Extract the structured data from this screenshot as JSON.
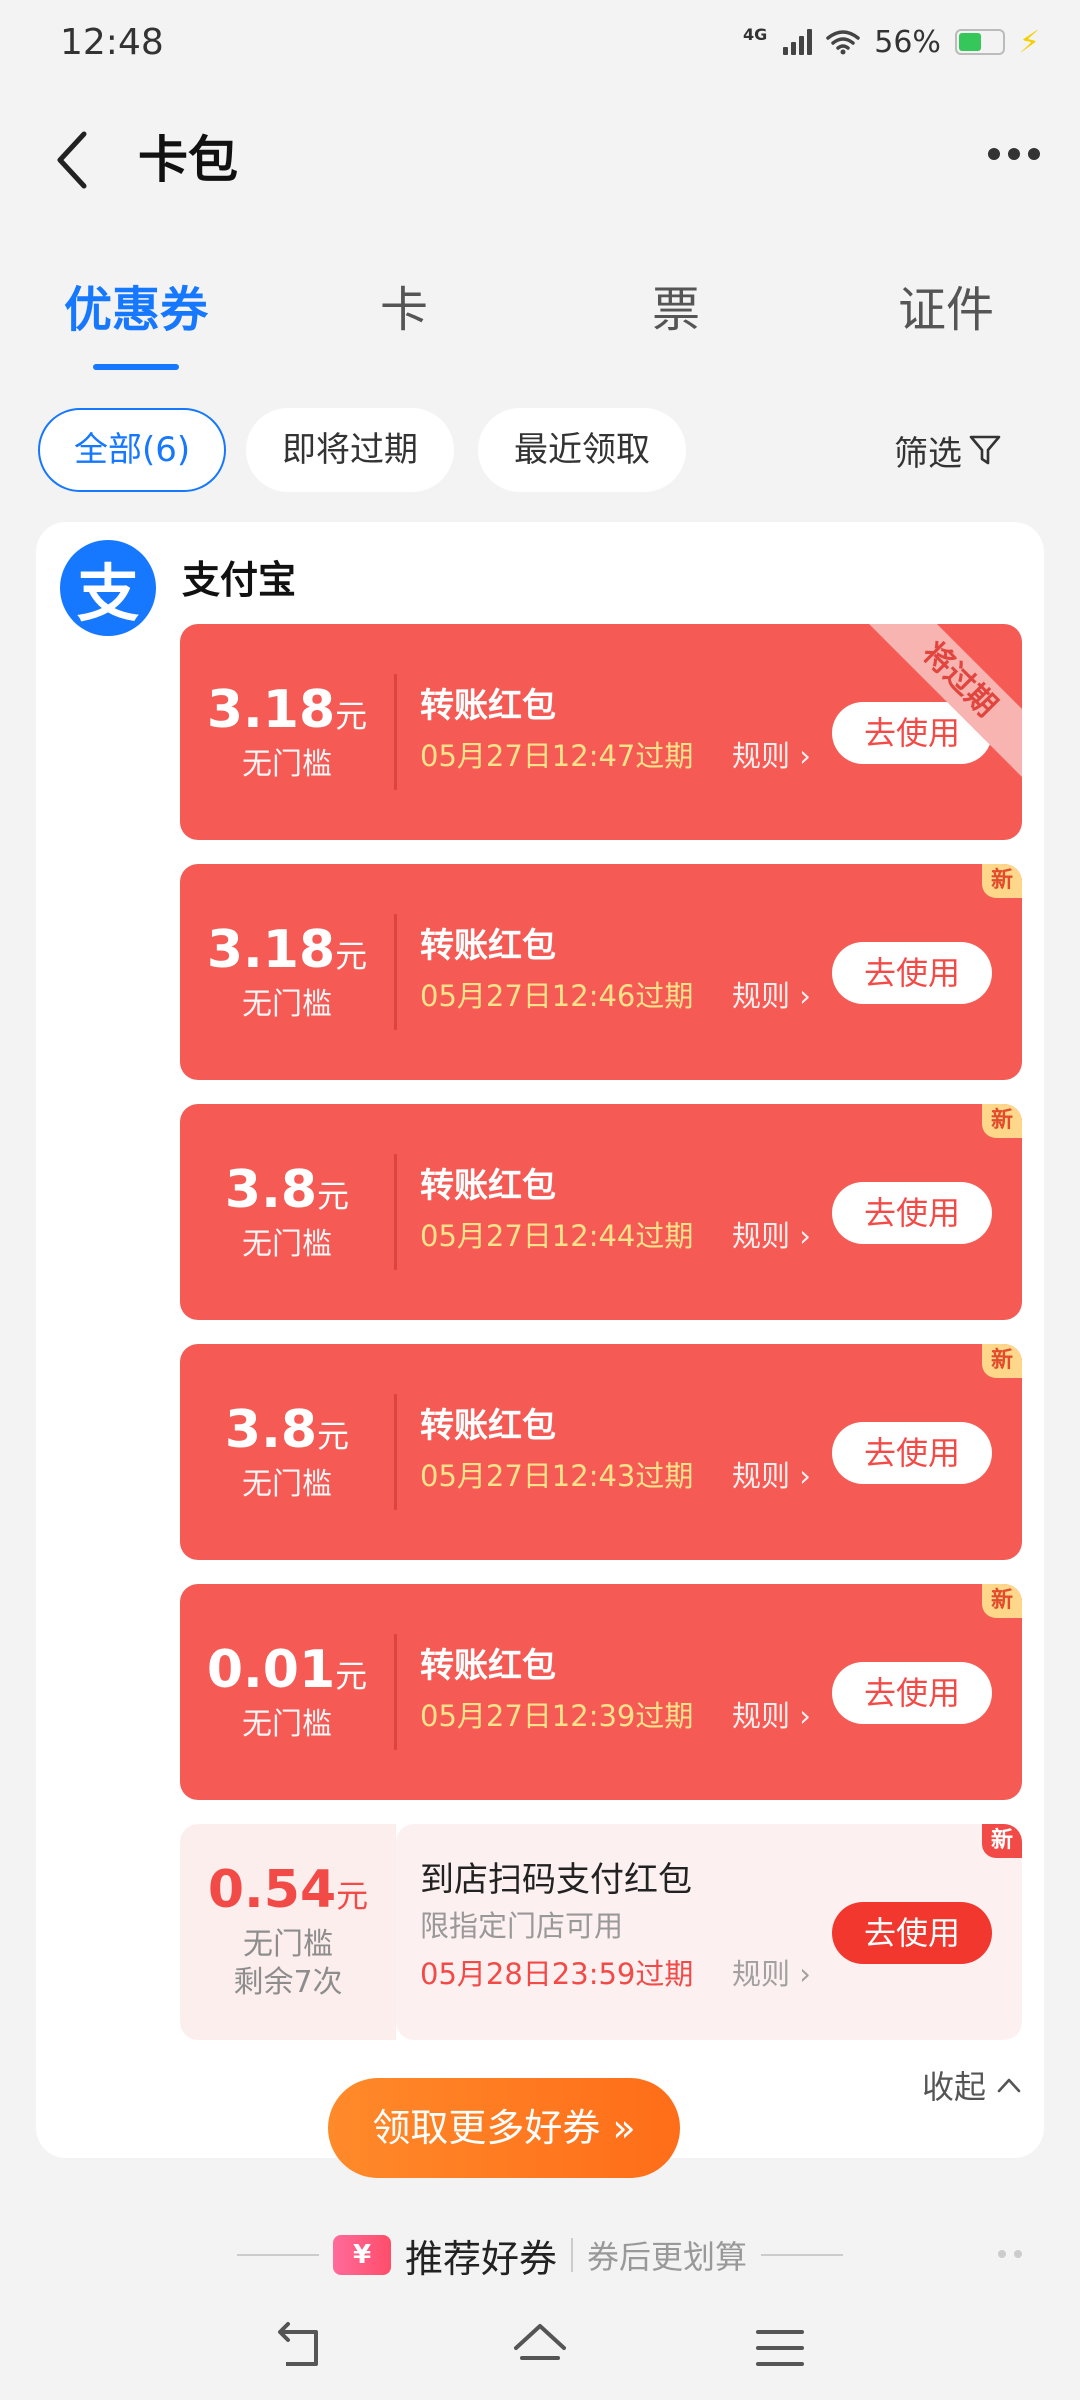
{
  "status": {
    "time": "12:48",
    "network": "4G",
    "battery": "56%",
    "battery_level": 0.56
  },
  "header": {
    "title": "卡包",
    "back_icon": "chevron-left-icon",
    "more_icon": "more-dots-icon"
  },
  "tabs": [
    {
      "label": "优惠券",
      "active": true
    },
    {
      "label": "卡",
      "active": false
    },
    {
      "label": "票",
      "active": false
    },
    {
      "label": "证件",
      "active": false
    }
  ],
  "filters": {
    "chips": [
      {
        "label": "全部(6)",
        "active": true
      },
      {
        "label": "即将过期",
        "active": false
      },
      {
        "label": "最近领取",
        "active": false
      }
    ],
    "filter_label": "筛选"
  },
  "brand": {
    "logo_glyph": "支",
    "name": "支付宝"
  },
  "coupons": [
    {
      "amount": "3.18",
      "unit": "元",
      "threshold": "无门槛",
      "name": "转账红包",
      "expire": "05月27日12:47过期",
      "rule": "规则 ›",
      "button": "去使用",
      "ribbon": "将过期"
    },
    {
      "amount": "3.18",
      "unit": "元",
      "threshold": "无门槛",
      "name": "转账红包",
      "expire": "05月27日12:46过期",
      "rule": "规则 ›",
      "button": "去使用",
      "badge": "新"
    },
    {
      "amount": "3.8",
      "unit": "元",
      "threshold": "无门槛",
      "name": "转账红包",
      "expire": "05月27日12:44过期",
      "rule": "规则 ›",
      "button": "去使用",
      "badge": "新"
    },
    {
      "amount": "3.8",
      "unit": "元",
      "threshold": "无门槛",
      "name": "转账红包",
      "expire": "05月27日12:43过期",
      "rule": "规则 ›",
      "button": "去使用",
      "badge": "新"
    },
    {
      "amount": "0.01",
      "unit": "元",
      "threshold": "无门槛",
      "name": "转账红包",
      "expire": "05月27日12:39过期",
      "rule": "规则 ›",
      "button": "去使用",
      "badge": "新"
    },
    {
      "amount": "0.54",
      "unit": "元",
      "threshold": "无门槛",
      "remaining": "剩余7次",
      "name": "到店扫码支付红包",
      "scope": "限指定门店可用",
      "expire": "05月28日23:59过期",
      "rule": "规则 ›",
      "button": "去使用",
      "badge": "新"
    }
  ],
  "collapse_label": "收起",
  "more_coupons_label": "领取更多好券 »",
  "recommend": {
    "icon_glyph": "¥",
    "title": "推荐好券",
    "subtitle": "券后更划算"
  },
  "colors": {
    "accent": "#1677ff",
    "coupon_red": "#f65a55",
    "expire_yellow": "#ffe28a",
    "orange": "#ff7a22"
  }
}
